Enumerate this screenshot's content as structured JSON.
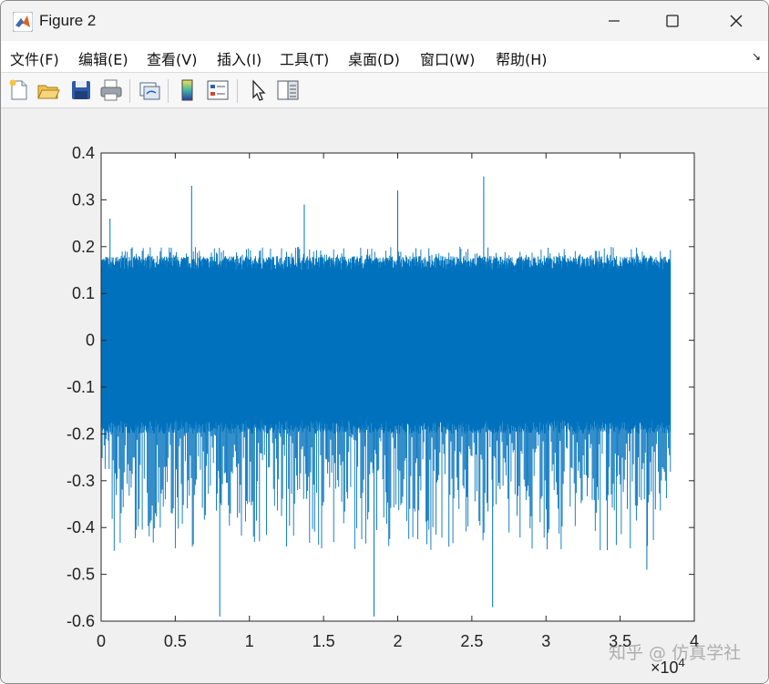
{
  "window": {
    "title": "Figure 2",
    "controls": [
      "minimize",
      "maximize",
      "close"
    ]
  },
  "menu": {
    "items": [
      "文件(F)",
      "编辑(E)",
      "查看(V)",
      "插入(I)",
      "工具(T)",
      "桌面(D)",
      "窗口(W)",
      "帮助(H)"
    ]
  },
  "toolbar": {
    "buttons": [
      "new-figure-icon",
      "open-file-icon",
      "save-icon",
      "print-icon",
      "link-plot-icon",
      "insert-colorbar-icon",
      "insert-legend-icon",
      "edit-plot-arrow-icon",
      "property-editor-icon"
    ]
  },
  "colors": {
    "signal": "#0072BD",
    "axes_bg": "#ffffff",
    "figure_bg": "#f0f0f0"
  },
  "chart_data": {
    "type": "line",
    "title": "",
    "xlabel": "",
    "ylabel": "",
    "xlim": [
      0,
      40000
    ],
    "ylim": [
      -0.6,
      0.4
    ],
    "x_ticks": [
      "0",
      "0.5",
      "1",
      "1.5",
      "2",
      "2.5",
      "3",
      "3.5",
      "4"
    ],
    "y_ticks": [
      "0.4",
      "0.3",
      "0.2",
      "0.1",
      "0",
      "-0.1",
      "-0.2",
      "-0.3",
      "-0.4",
      "-0.5",
      "-0.6"
    ],
    "x_exponent_label": "×10",
    "x_exponent_power": "4",
    "grid": false,
    "series": [
      {
        "color": "#0072BD",
        "n_samples": 38400,
        "dense_band": [
          -0.17,
          0.15
        ],
        "typical_envelope": [
          -0.45,
          0.2
        ],
        "x": [
          600,
          6100,
          8000,
          13700,
          18400,
          20000,
          25800,
          26400,
          36800
        ],
        "y": [
          0.26,
          0.33,
          -0.59,
          0.29,
          -0.59,
          0.32,
          0.35,
          -0.57,
          -0.49
        ]
      }
    ]
  },
  "watermark": "知乎 @ 仿真学社"
}
